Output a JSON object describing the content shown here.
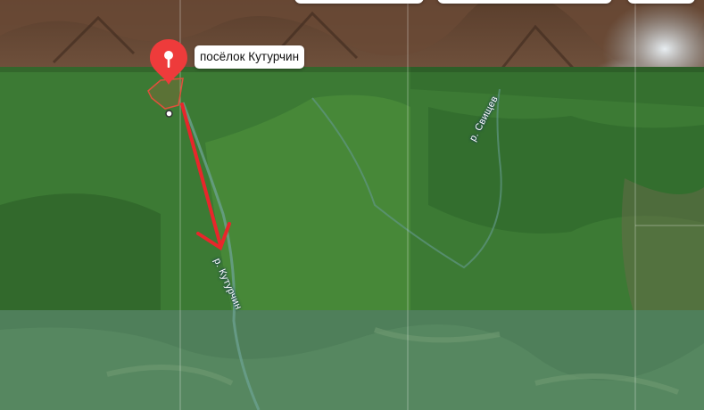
{
  "map": {
    "place_label": "посёлок Кутурчин",
    "rivers": [
      {
        "name": "р. Свищев"
      },
      {
        "name": "р. Кутурчин"
      }
    ],
    "marker": {
      "icon": "location-pin-icon",
      "color": "#ee3b3b"
    },
    "annotation_arrow_color": "#e8262b"
  }
}
